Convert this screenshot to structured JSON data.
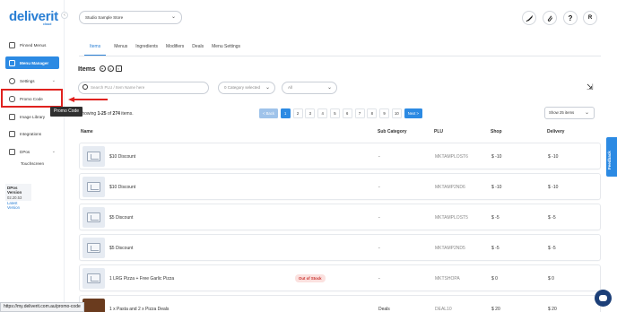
{
  "brand": {
    "logo": "deliverit",
    "sub": "cloud",
    "accent": "#2c8ae3"
  },
  "sidebar": {
    "items": [
      {
        "label": "Pinned Menus",
        "icon": "pin-icon"
      },
      {
        "label": "Menu Manager",
        "icon": "menu-icon",
        "active": true
      },
      {
        "label": "Settings",
        "icon": "gear-icon",
        "chevron": "⌄"
      },
      {
        "label": "Promo Code",
        "icon": "tag-icon"
      },
      {
        "label": "Image Library",
        "icon": "image-icon"
      },
      {
        "label": "Integrations",
        "icon": "plug-icon"
      },
      {
        "label": "DPos",
        "icon": "pos-icon",
        "chevron": "⌄"
      }
    ],
    "sub_item": "Touchscreen",
    "tooltip": "Promo Code",
    "version": {
      "title": "DPos Version",
      "number": "02.20.53",
      "link": "Latest Version"
    }
  },
  "header": {
    "store": "Studio Sample Store",
    "icons": [
      "rocket-icon",
      "attachment-icon",
      "help-icon",
      "user-avatar"
    ],
    "help_glyph": "?",
    "avatar_letter": "R"
  },
  "tabs": [
    "Items",
    "Menus",
    "Ingredients",
    "Modifiers",
    "Deals",
    "Menu Settings"
  ],
  "page_title": "Items",
  "filters": {
    "search_placeholder": "Search PLU / Item Name here",
    "category": "0 Category selected",
    "type": "All"
  },
  "pagination": {
    "showing_prefix": "Showing",
    "showing_range": "1-25",
    "showing_of": "of",
    "showing_total": "274",
    "showing_suffix": "items.",
    "prev": "< Back",
    "pages": [
      "1",
      "2",
      "3",
      "4",
      "5",
      "6",
      "7",
      "8",
      "9",
      "10"
    ],
    "next": "Next >",
    "per_page": "Show 25 items"
  },
  "table": {
    "headers": [
      "Name",
      "Sub Category",
      "PLU",
      "Shop",
      "Delivery"
    ],
    "rows": [
      {
        "name": "$10 Discount",
        "sub": "-",
        "plu": "MKTAMPLOST6",
        "shop": "$ -10",
        "delivery": "$ -10"
      },
      {
        "name": "$10 Discount",
        "sub": "-",
        "plu": "MKTAMP2ND6",
        "shop": "$ -10",
        "delivery": "$ -10"
      },
      {
        "name": "$5 Discount",
        "sub": "-",
        "plu": "MKTAMPLOST5",
        "shop": "$ -5",
        "delivery": "$ -5"
      },
      {
        "name": "$5 Discount",
        "sub": "-",
        "plu": "MKTAMP2ND5",
        "shop": "$ -5",
        "delivery": "$ -5"
      },
      {
        "name": "1 LRG Pizza + Free Garlic Pizza",
        "sub": "-",
        "plu": "MKTSHOPA",
        "shop": "$ 0",
        "delivery": "$ 0",
        "badge": "Out of Stock"
      },
      {
        "name": "1 x Pasta and 2 x Pizza Deals",
        "sub": "Deals",
        "plu": "DEAL10",
        "shop": "$ 20",
        "delivery": "$ 20"
      }
    ]
  },
  "status_url": "https://my.deliverit.com.au/promo-code",
  "feedback": "Feedback"
}
